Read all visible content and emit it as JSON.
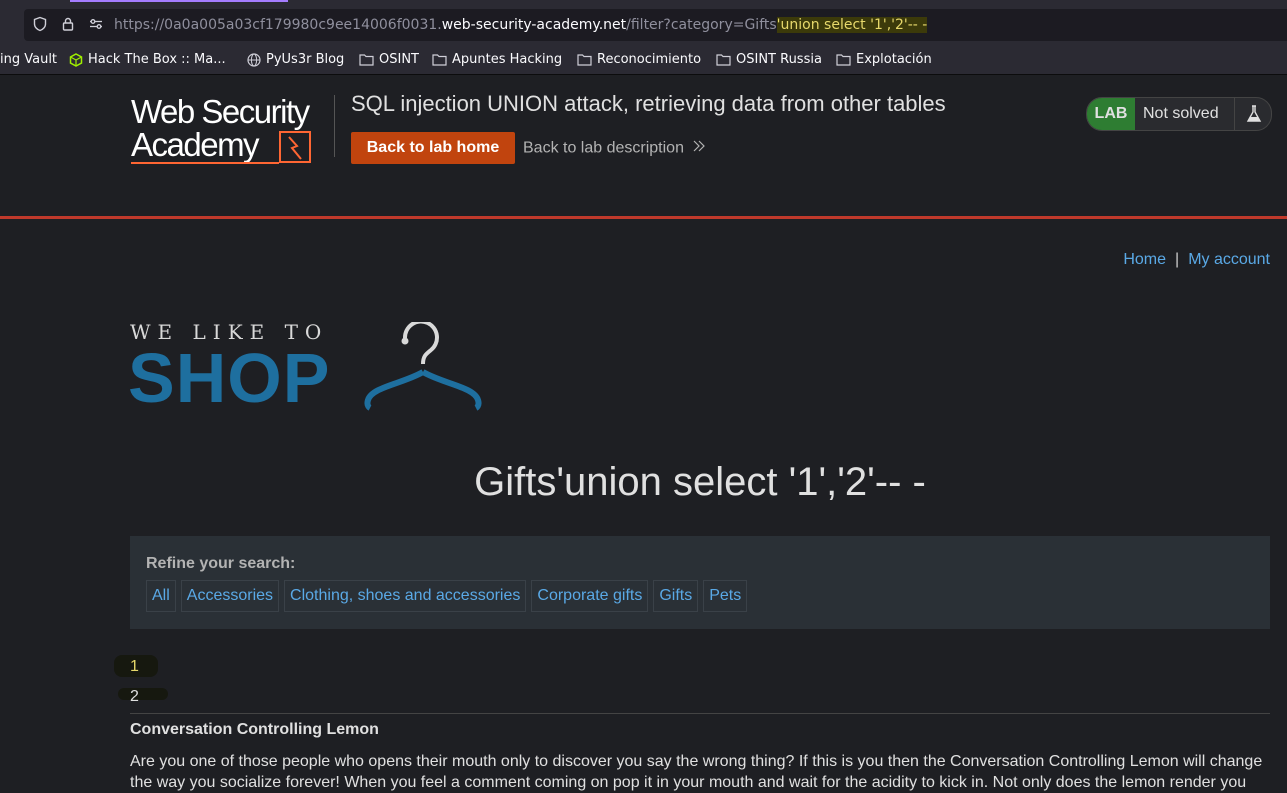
{
  "browser": {
    "url_prefix": "https://0a0a005a03cf179980c9ee14006f0031.",
    "url_host": "web-security-academy.net",
    "url_path": "/filter?category=Gifts",
    "url_highlight": "'union select '1','2'-- -"
  },
  "bookmarks": [
    {
      "label": "ing Vault",
      "icon": "none"
    },
    {
      "label": "Hack The Box :: Ma...",
      "icon": "hackthebox-icon"
    },
    {
      "label": "PyUs3r Blog",
      "icon": "globe-icon"
    },
    {
      "label": "OSINT",
      "icon": "folder-icon"
    },
    {
      "label": "Apuntes Hacking",
      "icon": "folder-icon"
    },
    {
      "label": "Reconocimiento",
      "icon": "folder-icon"
    },
    {
      "label": "OSINT Russia",
      "icon": "folder-icon"
    },
    {
      "label": "Explotación",
      "icon": "folder-icon"
    }
  ],
  "lab": {
    "logo_line1": "Web Security",
    "logo_line2": "Academy",
    "title": "SQL injection UNION attack, retrieving data from other tables",
    "back_home": "Back to lab home",
    "back_description": "Back to lab description",
    "status_tag": "LAB",
    "status": "Not solved",
    "accent": "#c1440e",
    "status_color": "#2e7d32"
  },
  "nav": {
    "home": "Home",
    "separator": "|",
    "account": "My account"
  },
  "shop_logo": {
    "line1": "WE LIKE TO",
    "line2": "SHOP"
  },
  "category_title": "Gifts'union select '1','2'-- -",
  "refine": {
    "label": "Refine your search:",
    "filters": [
      "All",
      "Accessories",
      "Clothing, shoes and accessories",
      "Corporate gifts",
      "Gifts",
      "Pets"
    ]
  },
  "results": {
    "row1": "1",
    "row2": "2",
    "product_name": "Conversation Controlling Lemon",
    "product_desc": "Are you one of those people who opens their mouth only to discover you say the wrong thing? If this is you then the Conversation Controlling Lemon will change the way you socialize forever! When you feel a comment coming on pop it in your mouth and wait for the acidity to kick in. Not only does the lemon render you"
  }
}
